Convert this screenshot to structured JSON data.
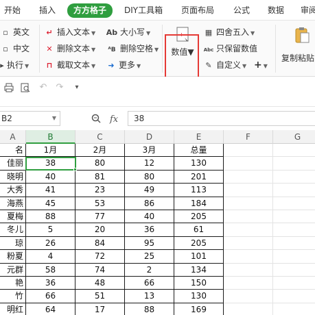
{
  "tabs": [
    {
      "label": "开始"
    },
    {
      "label": "插入"
    },
    {
      "label": "方方格子"
    },
    {
      "label": "DIY工具箱"
    },
    {
      "label": "页面布局"
    },
    {
      "label": "公式"
    },
    {
      "label": "数据"
    },
    {
      "label": "审阅"
    }
  ],
  "active_tab": "方方格子",
  "ribbon": {
    "english": "英文",
    "chinese": "中文",
    "execute": "执行",
    "insert_text": "插入文本",
    "delete_text": "删除文本",
    "extract_text": "截取文本",
    "case": "大小写",
    "delete_space": "删除空格",
    "more": "更多",
    "numeric": "数值",
    "round": "四舍五入",
    "keep_values": "只保留数值",
    "custom": "自定义",
    "plus": "+",
    "copy_paste": "复制粘贴"
  },
  "formula_bar": {
    "name_box": "B2",
    "fx": "fx",
    "value": "38"
  },
  "columns": [
    "A",
    "B",
    "C",
    "D",
    "E",
    "F",
    "G"
  ],
  "selected_column": "B",
  "header_row": [
    "名",
    "1月",
    "2月",
    "3月",
    "总量"
  ],
  "rows": [
    [
      "佳丽",
      "38",
      "80",
      "12",
      "130"
    ],
    [
      "晓明",
      "40",
      "81",
      "80",
      "201"
    ],
    [
      "大秀",
      "41",
      "23",
      "49",
      "113"
    ],
    [
      "海燕",
      "45",
      "53",
      "86",
      "184"
    ],
    [
      "夏梅",
      "88",
      "77",
      "40",
      "205"
    ],
    [
      "冬儿",
      "5",
      "20",
      "36",
      "61"
    ],
    [
      "琼",
      "26",
      "84",
      "95",
      "205"
    ],
    [
      "粉夏",
      "4",
      "72",
      "25",
      "101"
    ],
    [
      "元群",
      "58",
      "74",
      "2",
      "134"
    ],
    [
      "艳",
      "36",
      "48",
      "66",
      "150"
    ],
    [
      "竹",
      "66",
      "51",
      "13",
      "130"
    ],
    [
      "明红",
      "64",
      "17",
      "88",
      "169"
    ]
  ],
  "colors": {
    "accent_green": "#2f9e3f",
    "highlight_red": "#e53935"
  }
}
